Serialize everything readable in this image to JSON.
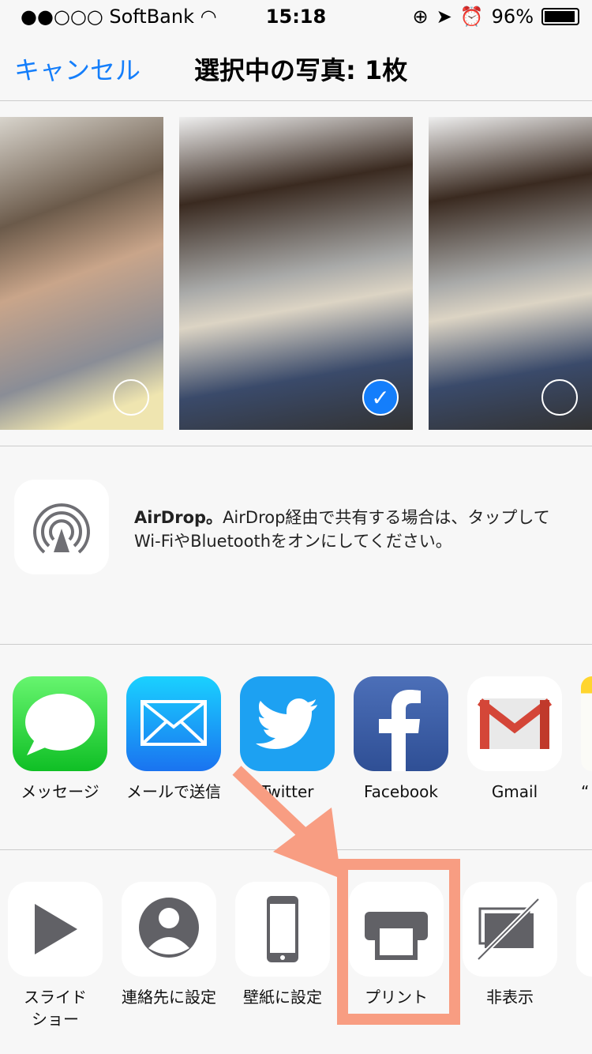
{
  "status": {
    "signal": "●●○○○",
    "carrier": "SoftBank",
    "time": "15:18",
    "battery": "96%",
    "battery_level": 0.96
  },
  "nav": {
    "cancel": "キャンセル",
    "title": "選択中の写真: 1枚"
  },
  "photos": [
    {
      "selected": false
    },
    {
      "selected": true
    },
    {
      "selected": false
    }
  ],
  "airdrop": {
    "title": "AirDrop。",
    "text": "AirDrop経由で共有する場合は、タップしてWi-FiやBluetoothをオンにしてください。"
  },
  "apps": [
    {
      "label": "メッセージ",
      "icon": "messages-icon"
    },
    {
      "label": "メールで送信",
      "icon": "mail-icon"
    },
    {
      "label": "Twitter",
      "icon": "twitter-icon"
    },
    {
      "label": "Facebook",
      "icon": "facebook-icon"
    },
    {
      "label": "Gmail",
      "icon": "gmail-icon"
    },
    {
      "label": "“",
      "icon": "notes-icon"
    }
  ],
  "actions": [
    {
      "label": "スライド\nショー",
      "icon": "play-icon"
    },
    {
      "label": "連絡先に設定",
      "icon": "contact-icon"
    },
    {
      "label": "壁紙に設定",
      "icon": "phone-icon"
    },
    {
      "label": "プリント",
      "icon": "printer-icon"
    },
    {
      "label": "非表示",
      "icon": "hide-icon"
    }
  ],
  "colors": {
    "accent": "#147efb",
    "annotation": "#f89d82"
  }
}
